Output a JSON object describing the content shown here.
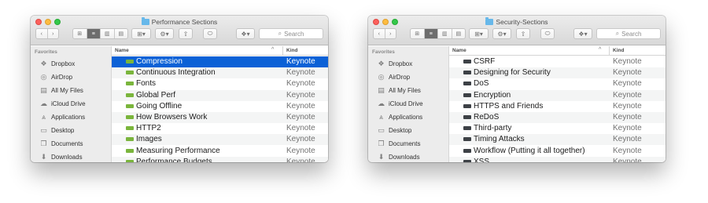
{
  "colors": {
    "selection": "#0b61d6",
    "keynote_green_icon": "#7ab53c",
    "keynote_dark_icon": "#3d4146"
  },
  "common": {
    "nav_back_icon": "chevron-left",
    "nav_forward_icon": "chevron-right",
    "search_placeholder": "Search",
    "sidebar_header": "Favorites",
    "col_name": "Name",
    "col_kind": "Kind",
    "sort_indicator": "^",
    "sidebar_items": [
      {
        "label": "Dropbox",
        "icon": "dropbox-icon",
        "glyph": "❖"
      },
      {
        "label": "AirDrop",
        "icon": "airdrop-icon",
        "glyph": "◎"
      },
      {
        "label": "All My Files",
        "icon": "all-files-icon",
        "glyph": "▤"
      },
      {
        "label": "iCloud Drive",
        "icon": "cloud-icon",
        "glyph": "☁"
      },
      {
        "label": "Applications",
        "icon": "applications-icon",
        "glyph": "⩓"
      },
      {
        "label": "Desktop",
        "icon": "desktop-icon",
        "glyph": "▭"
      },
      {
        "label": "Documents",
        "icon": "documents-icon",
        "glyph": "❐"
      },
      {
        "label": "Downloads",
        "icon": "downloads-icon",
        "glyph": "⬇"
      }
    ]
  },
  "window1": {
    "title": "Performance Sections",
    "files": [
      {
        "name": "Compression",
        "kind": "Keynote",
        "selected": true
      },
      {
        "name": "Continuous Integration",
        "kind": "Keynote"
      },
      {
        "name": "Fonts",
        "kind": "Keynote"
      },
      {
        "name": "Global Perf",
        "kind": "Keynote"
      },
      {
        "name": "Going Offline",
        "kind": "Keynote"
      },
      {
        "name": "How Browsers Work",
        "kind": "Keynote"
      },
      {
        "name": "HTTP2",
        "kind": "Keynote"
      },
      {
        "name": "Images",
        "kind": "Keynote"
      },
      {
        "name": "Measuring Performance",
        "kind": "Keynote"
      },
      {
        "name": "Performance Budgets",
        "kind": "Keynote"
      }
    ]
  },
  "window2": {
    "title": "Security-Sections",
    "files": [
      {
        "name": "CSRF",
        "kind": "Keynote"
      },
      {
        "name": "Designing for Security",
        "kind": "Keynote"
      },
      {
        "name": "DoS",
        "kind": "Keynote"
      },
      {
        "name": "Encryption",
        "kind": "Keynote"
      },
      {
        "name": "HTTPS and Friends",
        "kind": "Keynote"
      },
      {
        "name": "ReDoS",
        "kind": "Keynote"
      },
      {
        "name": "Third-party",
        "kind": "Keynote"
      },
      {
        "name": "Timing Attacks",
        "kind": "Keynote"
      },
      {
        "name": "Workflow (Putting it all together)",
        "kind": "Keynote"
      },
      {
        "name": "XSS",
        "kind": "Keynote"
      }
    ]
  }
}
